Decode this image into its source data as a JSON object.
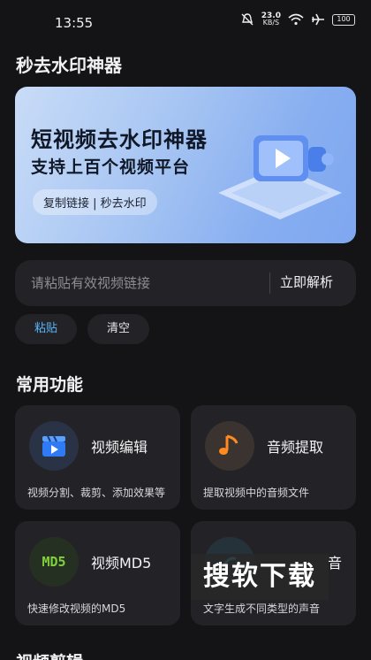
{
  "status_bar": {
    "time": "13:55",
    "net_speed": "23.0",
    "net_unit": "KB/S",
    "battery": "100"
  },
  "app": {
    "title": "秒去水印神器"
  },
  "banner": {
    "headline": "短视频去水印神器",
    "subline": "支持上百个视频平台",
    "chip": "复制链接 | 秒去水印"
  },
  "url_input": {
    "placeholder": "请粘贴有效视频链接",
    "value": "",
    "parse_label": "立即解析"
  },
  "actions": {
    "paste_label": "粘贴",
    "clear_label": "清空"
  },
  "features": {
    "section_title": "常用功能",
    "items": [
      {
        "name": "视频编辑",
        "desc": "视频分割、裁剪、添加效果等",
        "icon": "clapperboard-icon",
        "icon_color": "#2f7bf6"
      },
      {
        "name": "音频提取",
        "desc": "提取视频中的音频文件",
        "icon": "music-note-icon",
        "icon_color": "#ff8a1f"
      },
      {
        "name": "视频MD5",
        "desc": "快速修改视频的MD5",
        "icon": "md5-icon",
        "icon_color": "#7fd13b",
        "icon_text": "MD5"
      },
      {
        "name": "音",
        "desc": "文字生成不同类型的声音",
        "icon": "sound-icon",
        "icon_color": "#49c7f5"
      }
    ]
  },
  "watermark": {
    "text": "搜软下载"
  },
  "next_section_title": "视频剪辑"
}
